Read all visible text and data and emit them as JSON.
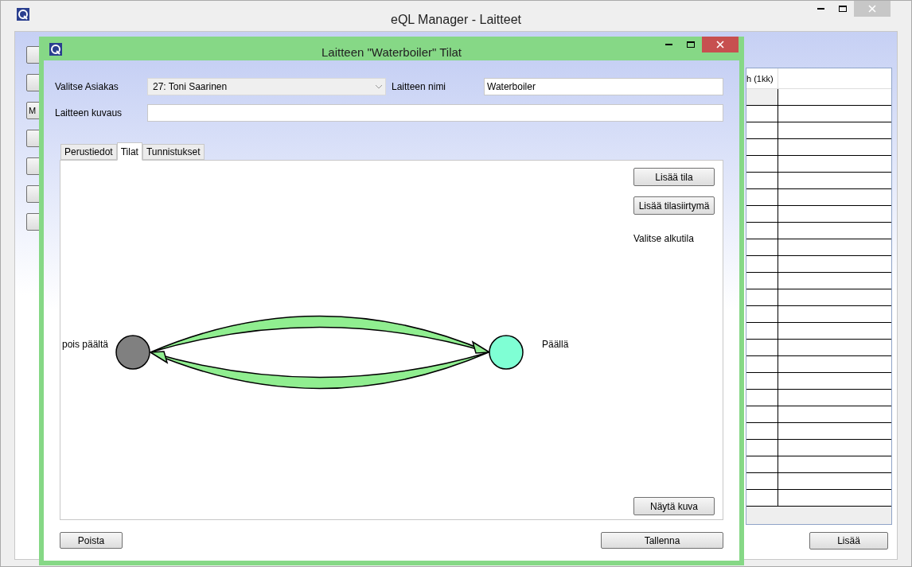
{
  "main_window": {
    "title": "eQL Manager - Laitteet",
    "partial_button_label": "M",
    "grid": {
      "columns": [
        "h (1kk)"
      ]
    },
    "buttons": [
      "Lisää"
    ]
  },
  "dialog": {
    "title": "Laitteen \"Waterboiler\" Tilat",
    "fields": [
      {
        "label": "Valitse Asiakas",
        "kind": "dropdown",
        "value": "27: Toni Saarinen"
      },
      {
        "label": "Laitteen nimi",
        "kind": "text",
        "value": "Waterboiler"
      },
      {
        "label": "Laitteen kuvaus",
        "kind": "text"
      }
    ],
    "tabs": [
      {
        "label": "Perustiedot",
        "selected": false
      },
      {
        "label": "Tilat",
        "selected": true
      },
      {
        "label": "Tunnistukset",
        "selected": false
      }
    ],
    "actions": [
      "Lisää tila",
      "Lisää tilasiirtymä"
    ],
    "hint": "Valitse alkutila",
    "states": [
      {
        "label": "pois päältä",
        "color": "#808080"
      },
      {
        "label": "Päällä",
        "color": "#7fffd4"
      }
    ],
    "show_image_button": "Näytä kuva",
    "footer_buttons": [
      "Poista",
      "Tallenna"
    ]
  }
}
